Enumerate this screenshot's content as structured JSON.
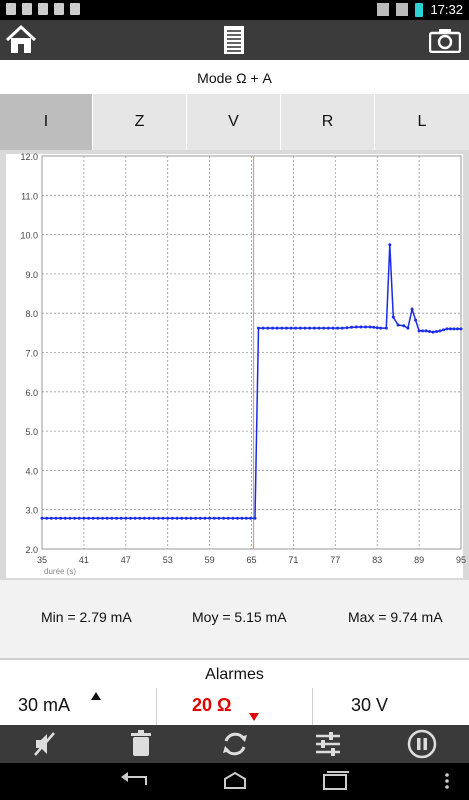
{
  "status_bar": {
    "time": "17:32"
  },
  "header": {
    "mode_title": "Mode Ω + A"
  },
  "tabs": [
    {
      "label": "I",
      "active": true
    },
    {
      "label": "Z",
      "active": false
    },
    {
      "label": "V",
      "active": false
    },
    {
      "label": "R",
      "active": false
    },
    {
      "label": "L",
      "active": false
    }
  ],
  "chart_data": {
    "type": "line",
    "xlabel": "durée (s)",
    "xticks": [
      "35",
      "41",
      "47",
      "53",
      "59",
      "65",
      "71",
      "77",
      "83",
      "89",
      "95"
    ],
    "yticks": [
      "2.0",
      "3.0",
      "4.0",
      "5.0",
      "6.0",
      "7.0",
      "8.0",
      "9.0",
      "10.0",
      "11.0",
      "12.0"
    ],
    "xlim": [
      35,
      95
    ],
    "ylim": [
      2.0,
      12.0
    ],
    "grid": true,
    "cursor_x": 65.3,
    "series": [
      {
        "color": "#1a2be8",
        "x": [
          35,
          37,
          39,
          41,
          43,
          45,
          47,
          49,
          51,
          53,
          55,
          57,
          59,
          61,
          63,
          65.5,
          66,
          68,
          70,
          72,
          74,
          76,
          78,
          80,
          82,
          83.5,
          84.3,
          84.8,
          85.3,
          86,
          86.8,
          87.4,
          88,
          89,
          90,
          91,
          92,
          93,
          94,
          95
        ],
        "y": [
          2.78,
          2.78,
          2.78,
          2.78,
          2.78,
          2.78,
          2.78,
          2.78,
          2.78,
          2.78,
          2.78,
          2.78,
          2.78,
          2.78,
          2.78,
          2.78,
          7.62,
          7.62,
          7.62,
          7.62,
          7.62,
          7.62,
          7.62,
          7.65,
          7.65,
          7.62,
          7.62,
          9.74,
          7.9,
          7.7,
          7.68,
          7.62,
          8.1,
          7.55,
          7.55,
          7.52,
          7.55,
          7.6,
          7.6,
          7.6
        ]
      }
    ]
  },
  "stats": {
    "min": "Min = 2.79 mA",
    "avg": "Moy = 5.15 mA",
    "max": "Max = 9.74 mA"
  },
  "alarms": {
    "title": "Alarmes",
    "current": "30 mA",
    "resistance": "20 Ω",
    "voltage": "30 V",
    "resistance_color": "#e00000"
  },
  "toolbar": {
    "icons": [
      "mute-icon",
      "trash-icon",
      "refresh-icon",
      "sliders-icon",
      "pause-icon"
    ]
  }
}
